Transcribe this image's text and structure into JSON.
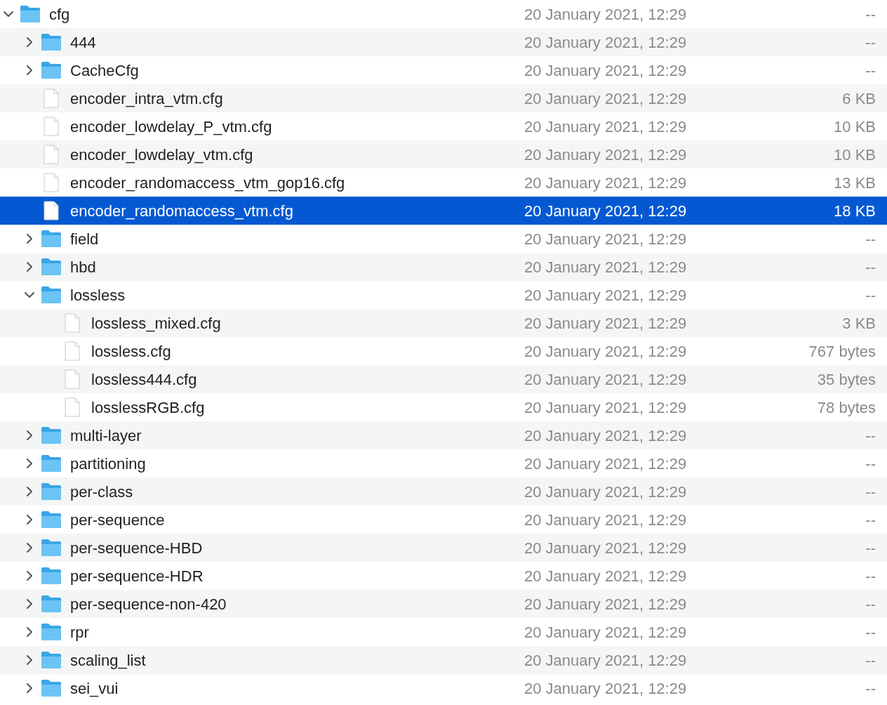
{
  "tree": [
    {
      "kind": "folder",
      "name": "cfg",
      "date": "20 January 2021, 12:29",
      "size": "--",
      "expanded": true,
      "selected": false,
      "children": [
        {
          "kind": "folder",
          "name": "444",
          "date": "20 January 2021, 12:29",
          "size": "--",
          "expanded": false,
          "selected": false
        },
        {
          "kind": "folder",
          "name": "CacheCfg",
          "date": "20 January 2021, 12:29",
          "size": "--",
          "expanded": false,
          "selected": false
        },
        {
          "kind": "file",
          "name": "encoder_intra_vtm.cfg",
          "date": "20 January 2021, 12:29",
          "size": "6 KB",
          "selected": false
        },
        {
          "kind": "file",
          "name": "encoder_lowdelay_P_vtm.cfg",
          "date": "20 January 2021, 12:29",
          "size": "10 KB",
          "selected": false
        },
        {
          "kind": "file",
          "name": "encoder_lowdelay_vtm.cfg",
          "date": "20 January 2021, 12:29",
          "size": "10 KB",
          "selected": false
        },
        {
          "kind": "file",
          "name": "encoder_randomaccess_vtm_gop16.cfg",
          "date": "20 January 2021, 12:29",
          "size": "13 KB",
          "selected": false
        },
        {
          "kind": "file",
          "name": "encoder_randomaccess_vtm.cfg",
          "date": "20 January 2021, 12:29",
          "size": "18 KB",
          "selected": true
        },
        {
          "kind": "folder",
          "name": "field",
          "date": "20 January 2021, 12:29",
          "size": "--",
          "expanded": false,
          "selected": false
        },
        {
          "kind": "folder",
          "name": "hbd",
          "date": "20 January 2021, 12:29",
          "size": "--",
          "expanded": false,
          "selected": false
        },
        {
          "kind": "folder",
          "name": "lossless",
          "date": "20 January 2021, 12:29",
          "size": "--",
          "expanded": true,
          "selected": false,
          "children": [
            {
              "kind": "file",
              "name": "lossless_mixed.cfg",
              "date": "20 January 2021, 12:29",
              "size": "3 KB",
              "selected": false
            },
            {
              "kind": "file",
              "name": "lossless.cfg",
              "date": "20 January 2021, 12:29",
              "size": "767 bytes",
              "selected": false
            },
            {
              "kind": "file",
              "name": "lossless444.cfg",
              "date": "20 January 2021, 12:29",
              "size": "35 bytes",
              "selected": false
            },
            {
              "kind": "file",
              "name": "losslessRGB.cfg",
              "date": "20 January 2021, 12:29",
              "size": "78 bytes",
              "selected": false
            }
          ]
        },
        {
          "kind": "folder",
          "name": "multi-layer",
          "date": "20 January 2021, 12:29",
          "size": "--",
          "expanded": false,
          "selected": false
        },
        {
          "kind": "folder",
          "name": "partitioning",
          "date": "20 January 2021, 12:29",
          "size": "--",
          "expanded": false,
          "selected": false
        },
        {
          "kind": "folder",
          "name": "per-class",
          "date": "20 January 2021, 12:29",
          "size": "--",
          "expanded": false,
          "selected": false
        },
        {
          "kind": "folder",
          "name": "per-sequence",
          "date": "20 January 2021, 12:29",
          "size": "--",
          "expanded": false,
          "selected": false
        },
        {
          "kind": "folder",
          "name": "per-sequence-HBD",
          "date": "20 January 2021, 12:29",
          "size": "--",
          "expanded": false,
          "selected": false
        },
        {
          "kind": "folder",
          "name": "per-sequence-HDR",
          "date": "20 January 2021, 12:29",
          "size": "--",
          "expanded": false,
          "selected": false
        },
        {
          "kind": "folder",
          "name": "per-sequence-non-420",
          "date": "20 January 2021, 12:29",
          "size": "--",
          "expanded": false,
          "selected": false
        },
        {
          "kind": "folder",
          "name": "rpr",
          "date": "20 January 2021, 12:29",
          "size": "--",
          "expanded": false,
          "selected": false
        },
        {
          "kind": "folder",
          "name": "scaling_list",
          "date": "20 January 2021, 12:29",
          "size": "--",
          "expanded": false,
          "selected": false
        },
        {
          "kind": "folder",
          "name": "sei_vui",
          "date": "20 January 2021, 12:29",
          "size": "--",
          "expanded": false,
          "selected": false
        }
      ]
    }
  ]
}
